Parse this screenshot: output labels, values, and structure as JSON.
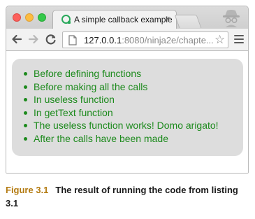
{
  "browser": {
    "tab": {
      "title": "A simple callback example",
      "close_glyph": "×",
      "favicon": "ninja-favicon-icon"
    },
    "toolbar": {
      "url_host": "127.0.0.1",
      "url_rest": ":8080/ninja2e/chapte...",
      "star_glyph": "☆",
      "icons": [
        "back-arrow-icon",
        "forward-arrow-icon",
        "reload-icon",
        "page-icon",
        "star-icon",
        "menu-icon"
      ]
    },
    "colors": {
      "log_text": "#1c8a1c",
      "panel_bg": "#dddddd",
      "caption_accent": "#b37a10"
    }
  },
  "page": {
    "log_items": [
      "Before defining functions",
      "Before making all the calls",
      "In useless function",
      "In getText function",
      "The useless function works! Domo arigato!",
      "After the calls have been made"
    ]
  },
  "caption": {
    "figure_label": "Figure 3.1",
    "text": "The result of running the code from listing 3.1"
  }
}
